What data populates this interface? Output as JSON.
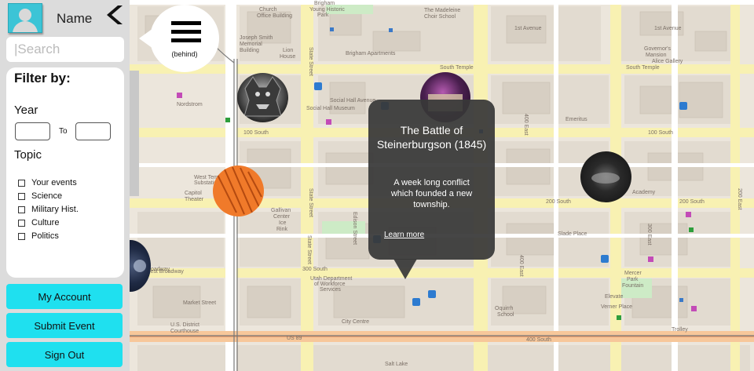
{
  "sidebar": {
    "user_name": "Name",
    "search_placeholder": "|Search",
    "filter": {
      "title": "Filter by:",
      "year_label": "Year",
      "to_label": "To",
      "topic_label": "Topic",
      "topics": [
        "Your events",
        "Science",
        "Military Hist.",
        "Culture",
        "Politics"
      ]
    },
    "buttons": {
      "account": "My Account",
      "submit": "Submit Event",
      "signout": "Sign Out"
    }
  },
  "menu": {
    "behind_label": "(behind)"
  },
  "popup": {
    "title": "The Battle of Steinerburgson (1845)",
    "description": "A week long conflict which founded a new township.",
    "link_label": "Learn more"
  },
  "map_labels": {
    "brigham": "Brigham",
    "young": "Young Historic",
    "park": "Park",
    "madeleine": "The Madeleine",
    "choir": "Choir School",
    "church": "Church",
    "office": "Office Building",
    "first_ave": "1st Avenue",
    "josephsmith": "Joseph Smith",
    "memorial": "Memorial",
    "building": "Building",
    "lion": "Lion",
    "house": "House",
    "state_street": "State Street",
    "brigham_apts": "Brigham Apartments",
    "governor": "Governor's",
    "mansion": "Mansion",
    "alice": "Alice Gallery",
    "south_temple": "South Temple",
    "nordstrom": "Nordstrom",
    "social_hall": "Social Hall Avenue",
    "shm": "Social Hall Museum",
    "emeritus": "Emeritus",
    "hundred_south": "100 South",
    "west_temple": "West Temple",
    "substation": "Substation",
    "capitol": "Capitol",
    "theater": "Theater",
    "gallivan": "Gallivan",
    "center": "Center",
    "ice": "Ice",
    "rink": "Rink",
    "two_south": "200 South",
    "slade": "Slade Place",
    "broadway": "Broadway",
    "w_broadway": "West Broadway",
    "three_south": "300 South",
    "utah_dept": "Utah Department",
    "workforce": "of Workforce",
    "services": "Services",
    "mercer": "Mercer",
    "park2": "Park",
    "fountain": "Fountain",
    "market": "Market Street",
    "us_district": "U.S. District",
    "courthouse": "Courthouse",
    "city_centre": "City Centre",
    "us89": "US 89",
    "four_south": "400 South",
    "trolley": "Trolley",
    "salt_lake": "Salt Lake",
    "edison": "Edison Street",
    "e400": "400 East",
    "e300": "300 East",
    "e200": "200 East",
    "oquirrh": "Oquirrh",
    "school": "School",
    "elevate": "Elevate",
    "verner": "Verner Place",
    "academy": "Academy",
    "on_broadway": "Broadway",
    "salt_house": "Salt Lake"
  }
}
